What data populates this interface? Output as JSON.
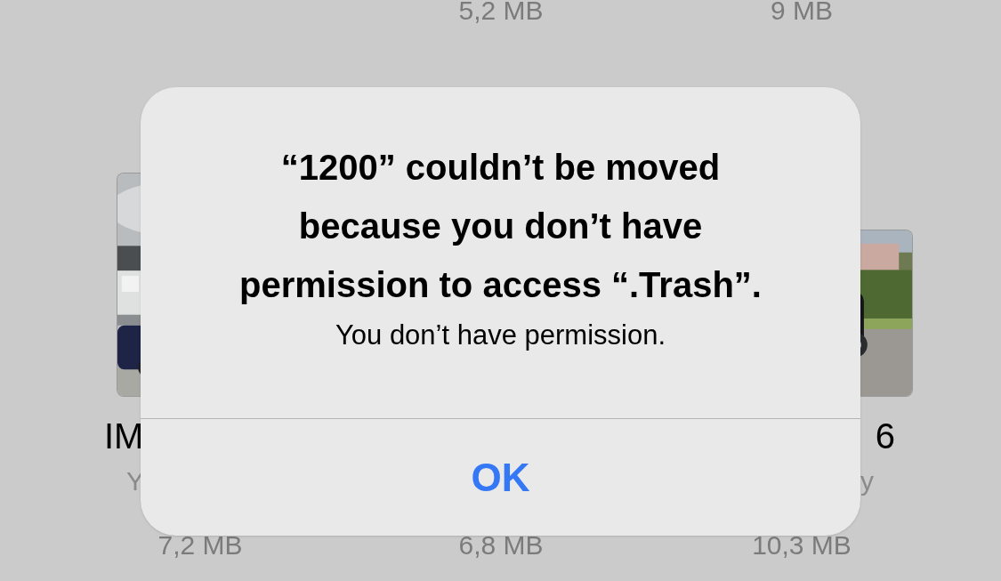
{
  "files_top": [
    {
      "size": "5,2 MB"
    },
    {
      "size": "9 MB"
    }
  ],
  "files": [
    {
      "name": "IM",
      "subtitle": "Y",
      "size": "7,2 MB"
    },
    {
      "size": "6,8 MB"
    },
    {
      "name": "6",
      "subtitle": "y",
      "size": "10,3 MB"
    }
  ],
  "alert": {
    "title": "“1200” couldn’t be moved because you don’t have permission to access “.Trash”.",
    "message": "You don’t have permission.",
    "buttons": [
      "OK"
    ]
  }
}
